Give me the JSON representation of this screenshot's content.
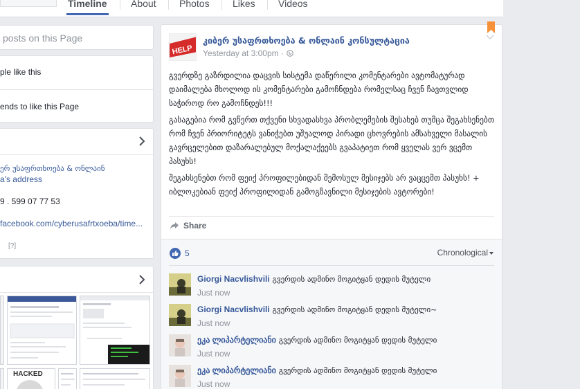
{
  "tabs": [
    {
      "label": "Timeline",
      "active": true
    },
    {
      "label": "About",
      "active": false
    },
    {
      "label": "Photos",
      "active": false
    },
    {
      "label": "Likes",
      "active": false
    },
    {
      "label": "Videos",
      "active": false
    }
  ],
  "left": {
    "posts_label": "posts on this Page",
    "likes_label": "ple like this",
    "invite_label": "ends to like this Page",
    "about": {
      "name_line": "ერ უსაფრთხოება & ონლაინ",
      "address_link": "a's address",
      "phone": "9 . 599 07 77 53",
      "website": "facebook.com/cyberusafrtxoeba/time...",
      "help_mark": "[?]"
    },
    "photo_labels": {
      "hacked": "HACKED"
    }
  },
  "post": {
    "page_name": "კიბერ უსაფრთხოება & ონლაინ კონსულტაცია",
    "time": "Yesterday at 3:00pm",
    "time_sep": "·",
    "avatar_text": "HELP",
    "paragraphs": [
      "გვერდზე გაზრდილია დაცვის სისტემა დაწერილი კომენტარები ავტომატურად დაიმალება მხოლოდ ის კომენტარები გამოჩნდება რომელსაც ჩვენ ჩავთვლიდ საჭიროდ რო გამოჩნდეს!!!",
      "გასაგებია რომ გვწერთ თქვენი სხვადასხვა პრობლემების შესახებ თუმცა შეგახსენებთ რომ ჩვენ პრიორიტეტს ვანიჭებთ უშუალოდ პირადი ცხოვრების ამსახველი მასალის გავრცელებით დაზარალებულ მოქალაქეებს გვაპატიეთ რომ ყველას ვერ ვცემთ პასუხს!",
      "შეგახსენებთ რომ ფეიქ პროფილებიდან შემოსულ მესიჯებს არ ვაცცემთ პასუხს! + იბლოკებიან ფეიქ პროფილიდან გამოგზავნილი მესიჯების ავტორები!"
    ],
    "share_label": "Share",
    "likes_count": "5",
    "sort_label": "Chronological",
    "comments": [
      {
        "name": "Giorgi Nacvlishvili",
        "text": "გვერდის ადმინო მოგიტყან დედის მუტელი",
        "time": "Just now"
      },
      {
        "name": "Giorgi Nacvlishvili",
        "text": "გვერდის ადმინო მოგიტყან დედის მუტელი~",
        "time": "Just now"
      },
      {
        "name": "ეკა ლიპარტელიანი",
        "text": "გვერდის ადმინო მოგიტყან დედის მუტელი",
        "time": "Just now"
      },
      {
        "name": "ეკა ლიპარტელიანი",
        "text": "გვერდის ადმინო მოგიტყან დედის მუტელი",
        "time": "Just now"
      }
    ]
  }
}
